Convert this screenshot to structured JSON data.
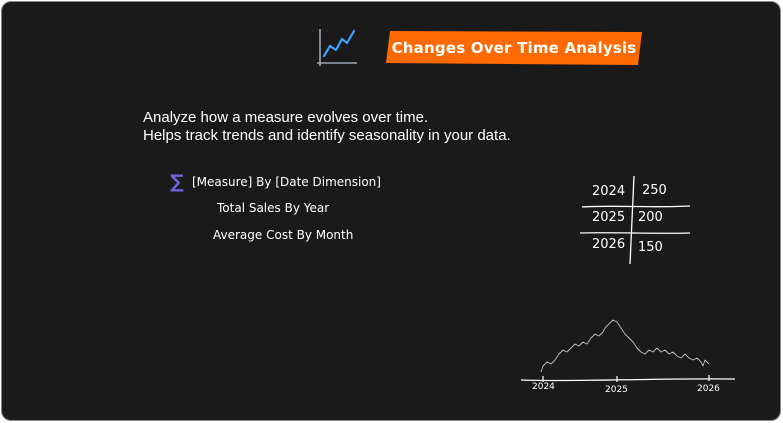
{
  "header": {
    "title": "Changes Over Time Analysis",
    "icon": "line-chart-icon",
    "banner_color": "#ff6a00",
    "icon_color": "#3fa0ff"
  },
  "description": {
    "line1": "Analyze how a measure evolves over time.",
    "line2": "Helps track trends and identify seasonality in your data."
  },
  "formula": {
    "icon": "sigma-icon",
    "icon_color": "#6b63d9",
    "pattern": "[Measure] By [Date Dimension]",
    "examples": [
      "Total Sales By Year",
      "Average Cost By Month"
    ]
  },
  "table": {
    "rows": [
      {
        "year": "2024",
        "value": "250"
      },
      {
        "year": "2025",
        "value": "200"
      },
      {
        "year": "2026",
        "value": "150"
      }
    ]
  },
  "sparkline": {
    "axis_labels": [
      "2024",
      "2025",
      "2026"
    ]
  }
}
